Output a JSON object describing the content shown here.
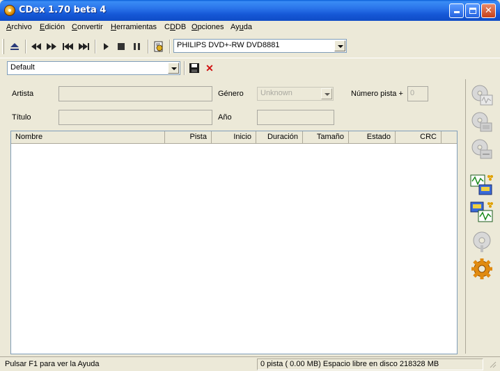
{
  "window": {
    "title": "CDex 1.70 beta 4"
  },
  "menu": [
    "Archivo",
    "Edición",
    "Convertir",
    "Herramientas",
    "CDDB",
    "Opciones",
    "Ayuda"
  ],
  "menu_underline": [
    "A",
    "E",
    "C",
    "H",
    "D",
    "O",
    "u"
  ],
  "toolbar": {
    "drive_select": "PHILIPS DVD+-RW DVD8881",
    "profile_select": "Default"
  },
  "form": {
    "artist_label": "Artista",
    "title_label": "Título",
    "genre_label": "Género",
    "genre_value": "Unknown",
    "year_label": "Año",
    "track_number_label": "Número pista +",
    "track_number_value": "0"
  },
  "table": {
    "columns": [
      "Nombre",
      "Pista",
      "Inicio",
      "Duración",
      "Tamaño",
      "Estado",
      "CRC"
    ]
  },
  "status": {
    "help": "Pulsar F1 para ver la Ayuda",
    "info": "0 pista ( 0.00 MB) Espacio libre en disco 218328 MB"
  },
  "colors": {
    "titlebar": "#1557d6",
    "window_bg": "#ece9d8",
    "close_button": "#c7401a"
  }
}
